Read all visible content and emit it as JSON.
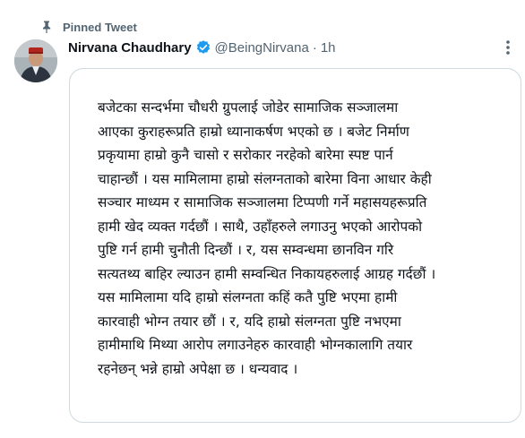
{
  "pinned": {
    "label": "Pinned Tweet"
  },
  "tweet": {
    "author_name": "Nirvana Chaudhary",
    "handle": "@BeingNirvana",
    "separator": "·",
    "time": "1h",
    "lines": [
      "बजेटका सन्दर्भमा चौधरी ग्रुपलाई जोडेर सामाजिक सञ्जालमा",
      "आएका कुराहरूप्रति हाम्रो ध्यानाकर्षण भएको छ । बजेट निर्माण",
      "प्रकृयामा हाम्रो कुनै चासो र सरोकार नरहेको बारेमा स्पष्ट पार्न",
      "चाहान्छौं । यस मामिलामा हाम्रो संलग्नताको बारेमा विना आधार केही",
      "सञ्चार माध्यम र सामाजिक सञ्जालमा टिप्पणी गर्ने महासयहरूप्रति",
      "हामी खेद व्यक्त गर्दछौं । साथै, उहाँहरुले लगाउनु भएको आरोपको",
      "पुष्टि गर्न हामी चुनौती दिन्छौं । र, यस सम्वन्धमा छानविन गरि",
      "सत्यतथ्य बाहिर ल्याउन हामी सम्वन्धित निकायहरुलाई आग्रह गर्दछौं ।",
      "यस मामिलामा यदि हाम्रो संलग्नता कहिं कतै पुष्टि भएमा हामी",
      "कारवाही भोग्न तयार छौं । र, यदि हाम्रो संलग्नता पुष्टि नभएमा",
      "हामीमाथि मिथ्या आरोप लगाउनेहरु कारवाही भोग्नकालागि तयार",
      "रहनेछन् भन्ने हाम्रो अपेक्षा छ । धन्यवाद ।"
    ]
  },
  "icons": {
    "pin": "pin-icon",
    "verified": "verified-badge-icon",
    "more": "more-options-icon"
  },
  "colors": {
    "text": "#0f1419",
    "secondary": "#536471",
    "verified": "#1d9bf0",
    "border": "#cfd9de"
  }
}
